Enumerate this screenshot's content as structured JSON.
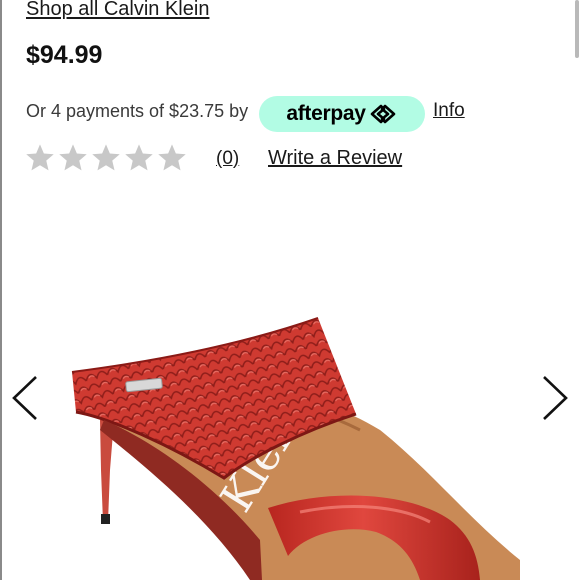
{
  "product": {
    "brand_link": "Shop all Calvin Klein",
    "price": "$94.99",
    "image_alt": "Red snake-embossed heeled mule sandal",
    "logo_text": "Calvin Klein"
  },
  "payment": {
    "installments_text": "Or 4 payments of $23.75 by",
    "provider_wordmark": "afterpay",
    "provider_icon": "afterpay-arrows-icon",
    "info_link": "Info"
  },
  "reviews": {
    "rating": 0,
    "max_rating": 5,
    "count_label": "(0)",
    "write_review_label": "Write a Review"
  },
  "carousel": {
    "prev_icon": "chevron-left-icon",
    "next_icon": "chevron-right-icon"
  },
  "colors": {
    "afterpay_mint": "#b2fce4",
    "star_empty": "#c8c8c8",
    "shoe_red": "#c8352d",
    "lining_tan": "#c98a56"
  }
}
